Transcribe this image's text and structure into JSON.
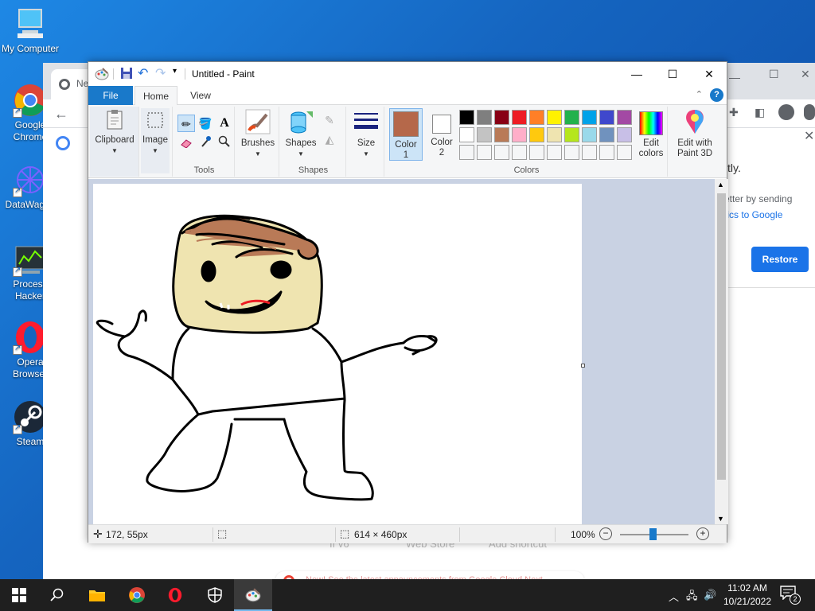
{
  "desktop": {
    "icons": [
      {
        "label": "My Computer"
      },
      {
        "label": "Google Chrome"
      },
      {
        "label": "DataWagon"
      },
      {
        "label": "Process Hacker"
      },
      {
        "label": "Opera Browser"
      },
      {
        "label": "Steam"
      }
    ]
  },
  "chrome": {
    "tab_label": "Ne",
    "body_text_1": "tly.",
    "body_text_2": "etter by sending",
    "body_text_3": "stics to Google",
    "restore_label": "Restore",
    "footer_items": [
      "If v6",
      "Web Store",
      "Add shortcut"
    ],
    "bottom_banner": "New! See the latest announcements from Google Cloud Next"
  },
  "paint": {
    "title": "Untitled - Paint",
    "tabs": {
      "file": "File",
      "home": "Home",
      "view": "View"
    },
    "ribbon": {
      "clipboard": "Clipboard",
      "image": "Image",
      "tools_group": "Tools",
      "brushes": "Brushes",
      "shapes": "Shapes",
      "shapes_group": "Shapes",
      "size": "Size",
      "color1_line1": "Color",
      "color1_line2": "1",
      "color2_line1": "Color",
      "color2_line2": "2",
      "colors_group": "Colors",
      "edit_colors_line1": "Edit",
      "edit_colors_line2": "colors",
      "paint3d_line1": "Edit with",
      "paint3d_line2": "Paint 3D"
    },
    "color1": "#b5684a",
    "color2": "#ffffff",
    "palette_row1": [
      "#000000",
      "#7f7f7f",
      "#880015",
      "#ed1c24",
      "#ff7f27",
      "#fff200",
      "#22b14c",
      "#00a2e8",
      "#3f48cc",
      "#a349a4"
    ],
    "palette_row2": [
      "#ffffff",
      "#c3c3c3",
      "#b97a57",
      "#ffaec9",
      "#ffc90e",
      "#efe4b0",
      "#b5e61d",
      "#99d9ea",
      "#7092be",
      "#c8bfe7"
    ],
    "status": {
      "cursor": "172, 55px",
      "size": "614 × 460px",
      "zoom": "100%"
    }
  },
  "taskbar": {
    "time": "11:02 AM",
    "date": "10/21/2022",
    "notifications": "2"
  }
}
